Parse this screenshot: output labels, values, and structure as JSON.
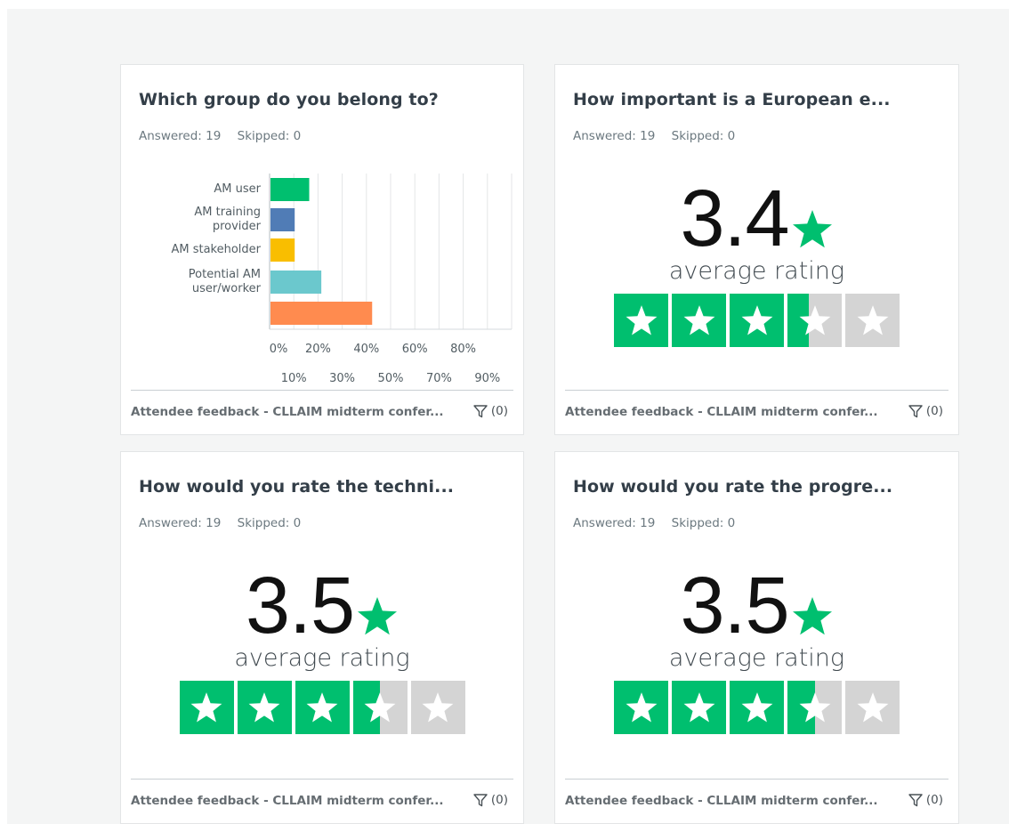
{
  "cards": [
    {
      "title": "Which group do you belong to?",
      "answered": "Answered: 19",
      "skipped": "Skipped: 0",
      "source": "Attendee feedback - CLLAIM midterm confer...",
      "filter_count": "(0)"
    },
    {
      "title": "How important is a European e...",
      "answered": "Answered: 19",
      "skipped": "Skipped: 0",
      "rating": "3.4",
      "rating_fraction": 0.68,
      "rating_label": "average rating",
      "source": "Attendee feedback - CLLAIM midterm confer...",
      "filter_count": "(0)"
    },
    {
      "title": "How would you rate the techni...",
      "answered": "Answered: 19",
      "skipped": "Skipped: 0",
      "rating": "3.5",
      "rating_fraction": 0.7,
      "rating_label": "average rating",
      "source": "Attendee feedback - CLLAIM midterm confer...",
      "filter_count": "(0)"
    },
    {
      "title": "How would you rate the progre...",
      "answered": "Answered: 19",
      "skipped": "Skipped: 0",
      "rating": "3.5",
      "rating_fraction": 0.7,
      "rating_label": "average rating",
      "source": "Attendee feedback - CLLAIM midterm confer...",
      "filter_count": "(0)"
    }
  ],
  "colors": {
    "accent_green": "#00bf6f",
    "star_empty": "#d4d4d4"
  },
  "chart_data": {
    "type": "bar",
    "orientation": "horizontal",
    "categories": [
      "AM user",
      "AM training provider",
      "AM stakeholder",
      "Potential AM user/worker",
      ""
    ],
    "values": [
      16,
      10,
      10,
      21,
      42
    ],
    "colors": [
      "#00bf6f",
      "#507cb6",
      "#f9be00",
      "#6bc8cd",
      "#ff8b4f"
    ],
    "x_ticks_row1": [
      "0%",
      "20%",
      "40%",
      "60%",
      "80%"
    ],
    "x_ticks_row2": [
      "10%",
      "30%",
      "50%",
      "70%",
      "90%"
    ],
    "xlim": [
      0,
      100
    ],
    "grid": true
  }
}
